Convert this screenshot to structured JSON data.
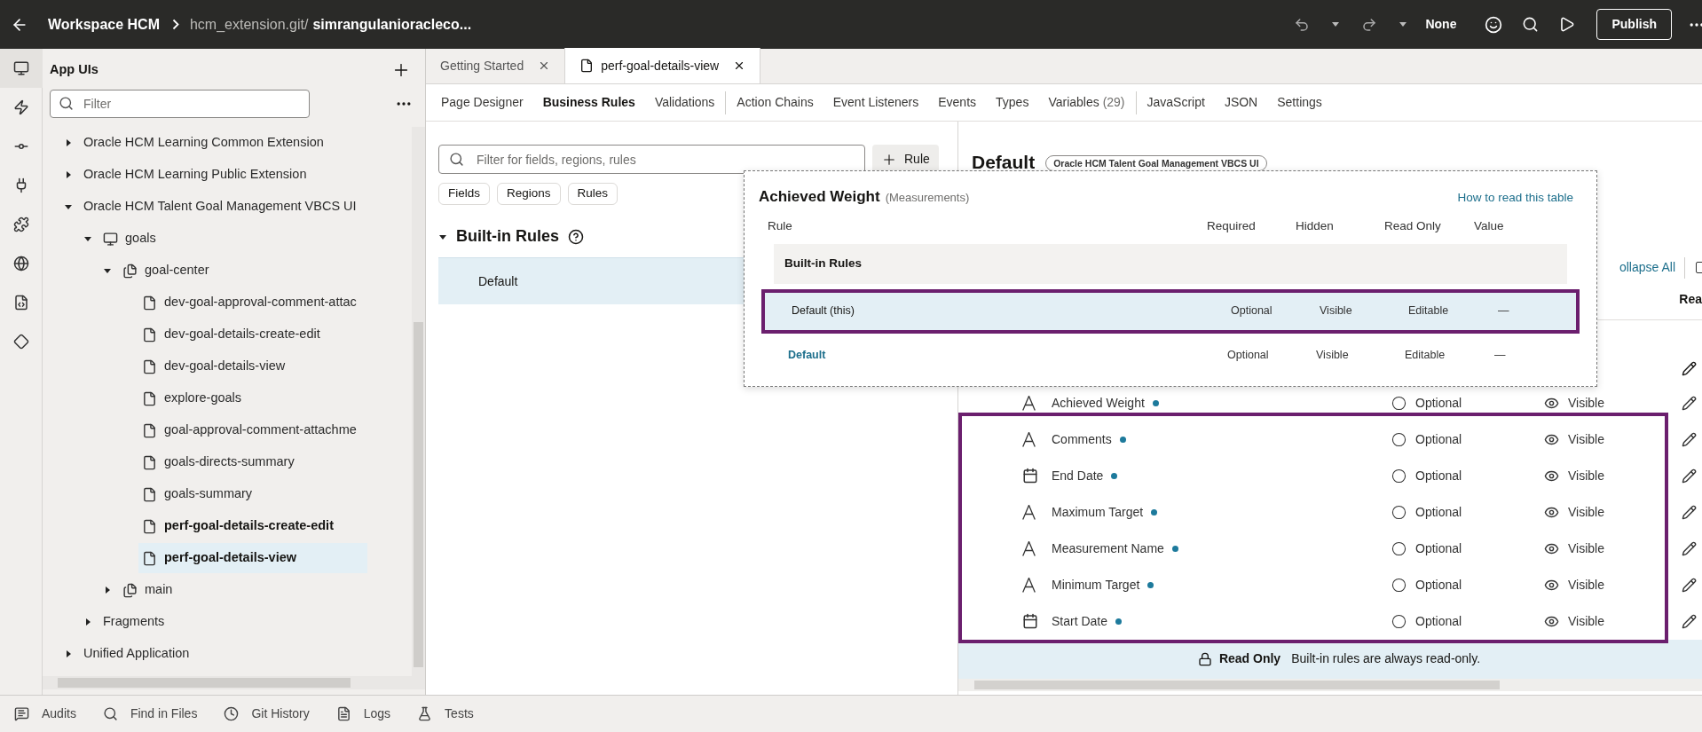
{
  "header": {
    "workspace": "Workspace HCM",
    "repo": "hcm_extension.git/",
    "branch": "simrangulanioracleco...",
    "mode": "None",
    "publish": "Publish"
  },
  "sidebar": {
    "title": "App UIs",
    "filter_placeholder": "Filter",
    "tree": [
      {
        "label": "Oracle HCM Learning Common Extension",
        "kind": "group",
        "expanded": false,
        "selected": false,
        "bold": false
      },
      {
        "label": "Oracle HCM Learning Public Extension",
        "kind": "group",
        "expanded": false,
        "selected": false,
        "bold": false
      },
      {
        "label": "Oracle HCM Talent Goal Management VBCS UI",
        "kind": "group",
        "expanded": true,
        "selected": false,
        "bold": false,
        "children": [
          {
            "label": "goals",
            "kind": "app",
            "expanded": true,
            "selected": false,
            "bold": false,
            "children": [
              {
                "label": "goal-center",
                "kind": "flow",
                "expanded": true,
                "selected": false,
                "bold": false,
                "children": [
                  {
                    "label": "dev-goal-approval-comment-attac",
                    "kind": "page",
                    "selected": false,
                    "bold": false
                  },
                  {
                    "label": "dev-goal-details-create-edit",
                    "kind": "page",
                    "selected": false,
                    "bold": false
                  },
                  {
                    "label": "dev-goal-details-view",
                    "kind": "page",
                    "selected": false,
                    "bold": false
                  },
                  {
                    "label": "explore-goals",
                    "kind": "page",
                    "selected": false,
                    "bold": false
                  },
                  {
                    "label": "goal-approval-comment-attachme",
                    "kind": "page",
                    "selected": false,
                    "bold": false
                  },
                  {
                    "label": "goals-directs-summary",
                    "kind": "page",
                    "selected": false,
                    "bold": false
                  },
                  {
                    "label": "goals-summary",
                    "kind": "page",
                    "selected": false,
                    "bold": false
                  },
                  {
                    "label": "perf-goal-details-create-edit",
                    "kind": "page",
                    "selected": false,
                    "bold": true
                  },
                  {
                    "label": "perf-goal-details-view",
                    "kind": "page",
                    "selected": true,
                    "bold": true
                  }
                ]
              },
              {
                "label": "main",
                "kind": "flow",
                "expanded": false,
                "selected": false,
                "bold": false
              }
            ]
          },
          {
            "label": "Fragments",
            "kind": "folder",
            "expanded": false,
            "selected": false,
            "bold": false
          }
        ]
      },
      {
        "label": "Unified Application",
        "kind": "group",
        "expanded": false,
        "selected": false,
        "bold": false
      }
    ]
  },
  "editor_tabs": [
    {
      "label": "Getting Started",
      "selected": false,
      "file_icon": false
    },
    {
      "label": "perf-goal-details-view",
      "selected": true,
      "file_icon": true
    }
  ],
  "sub_tabs": [
    {
      "label": "Page Designer",
      "selected": false
    },
    {
      "label": "Business Rules",
      "selected": true
    },
    {
      "label": "Validations",
      "selected": false,
      "divider_after": true
    },
    {
      "label": "Action Chains",
      "selected": false
    },
    {
      "label": "Event Listeners",
      "selected": false
    },
    {
      "label": "Events",
      "selected": false
    },
    {
      "label": "Types",
      "selected": false
    },
    {
      "label": "Variables",
      "count": "(29)",
      "selected": false,
      "divider_after": true
    },
    {
      "label": "JavaScript",
      "selected": false
    },
    {
      "label": "JSON",
      "selected": false
    },
    {
      "label": "Settings",
      "selected": false
    }
  ],
  "rules_pane": {
    "filter_placeholder": "Filter for fields, regions, rules",
    "add_button": "Rule",
    "chips": [
      "Fields",
      "Regions",
      "Rules"
    ],
    "section": "Built-in Rules",
    "section_expanded": true,
    "rules": [
      {
        "label": "Default",
        "selected": true
      }
    ]
  },
  "detail": {
    "title": "Default",
    "badge": "Oracle HCM Talent Goal Management VBCS UI",
    "collapse_link": "ollapse All",
    "checked": false,
    "column_header": "Rea",
    "fields": [
      {
        "label": "Achieved Weight",
        "kind": "text",
        "required": "Optional",
        "hidden": "Visible"
      },
      {
        "label": "Comments",
        "kind": "text",
        "required": "Optional",
        "hidden": "Visible"
      },
      {
        "label": "End Date",
        "kind": "date",
        "required": "Optional",
        "hidden": "Visible"
      },
      {
        "label": "Maximum Target",
        "kind": "text",
        "required": "Optional",
        "hidden": "Visible"
      },
      {
        "label": "Measurement Name",
        "kind": "text",
        "required": "Optional",
        "hidden": "Visible"
      },
      {
        "label": "Minimum Target",
        "kind": "text",
        "required": "Optional",
        "hidden": "Visible"
      },
      {
        "label": "Start Date",
        "kind": "date",
        "required": "Optional",
        "hidden": "Visible"
      }
    ],
    "banner_title": "Read Only",
    "banner_text": "Built-in rules are always read-only."
  },
  "popup": {
    "title": "Achieved Weight",
    "subtitle": "(Measurements)",
    "help_link": "How to read this table",
    "columns": [
      "Rule",
      "Required",
      "Hidden",
      "Read Only",
      "Value"
    ],
    "group": "Built-in Rules",
    "rows": [
      {
        "rule": "Default (this)",
        "kind": "current",
        "required": "Optional",
        "hidden": "Visible",
        "read_only": "Editable",
        "value": "—",
        "selected": true
      },
      {
        "rule": "Default",
        "kind": "link",
        "required": "Optional",
        "hidden": "Visible",
        "read_only": "Editable",
        "value": "—",
        "selected": false
      }
    ]
  },
  "bottom_bar": [
    {
      "label": "Audits",
      "kind": "audit"
    },
    {
      "label": "Find in Files",
      "kind": "search"
    },
    {
      "label": "Git History",
      "kind": "clock"
    },
    {
      "label": "Logs",
      "kind": "log"
    },
    {
      "label": "Tests",
      "kind": "flask"
    }
  ]
}
